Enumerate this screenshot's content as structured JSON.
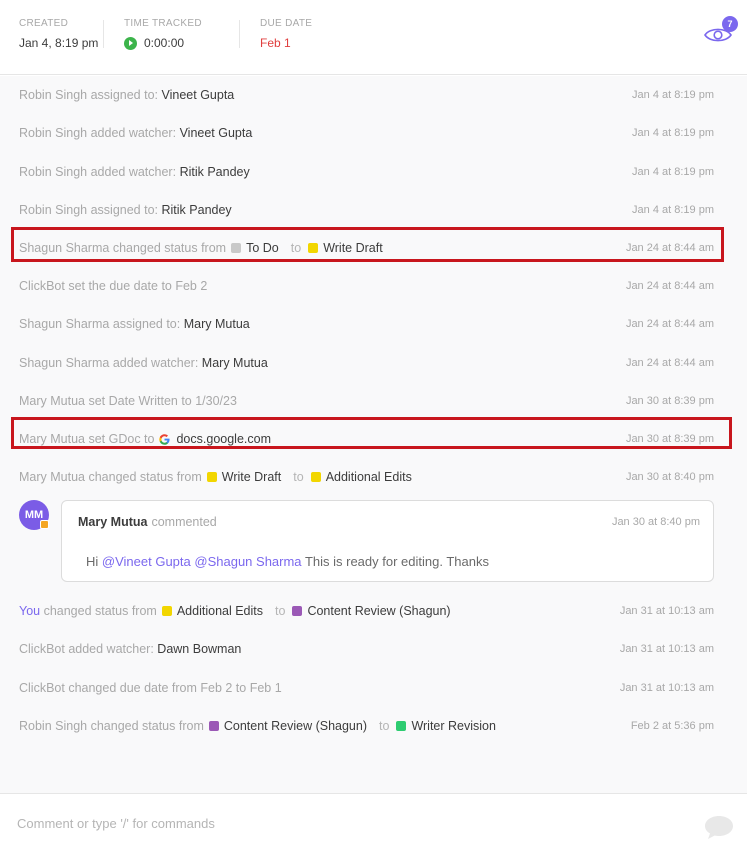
{
  "header": {
    "created": {
      "label": "CREATED",
      "value": "Jan 4, 8:19 pm"
    },
    "time_tracked": {
      "label": "TIME TRACKED",
      "value": "0:00:00"
    },
    "due_date": {
      "label": "DUE DATE",
      "value": "Feb 1"
    },
    "watchers_count": "7"
  },
  "colors": {
    "todo": "#c9c9c9",
    "write_draft": "#f2d600",
    "additional_edits": "#f2d600",
    "content_review": "#9b59b6",
    "writer_revision": "#2ecc71",
    "accent": "#7b68ee",
    "highlight": "#c8161d"
  },
  "activity": [
    {
      "actor": "Robin Singh",
      "action": "assigned to:",
      "target": "Vineet Gupta",
      "time": "Jan 4 at 8:19 pm"
    },
    {
      "actor": "Robin Singh",
      "action": "added watcher:",
      "target": "Vineet Gupta",
      "time": "Jan 4 at 8:19 pm"
    },
    {
      "actor": "Robin Singh",
      "action": "added watcher:",
      "target": "Ritik Pandey",
      "time": "Jan 4 at 8:19 pm"
    },
    {
      "actor": "Robin Singh",
      "action": "assigned to:",
      "target": "Ritik Pandey",
      "time": "Jan 4 at 8:19 pm"
    },
    {
      "actor": "Shagun Sharma",
      "action": "changed status from",
      "from": "To Do",
      "to_word": "to",
      "to": "Write Draft",
      "time": "Jan 24 at 8:44 am"
    },
    {
      "text": "ClickBot set the due date to Feb 2",
      "time": "Jan 24 at 8:44 am"
    },
    {
      "actor": "Shagun Sharma",
      "action": "assigned to:",
      "target": "Mary Mutua",
      "time": "Jan 24 at 8:44 am"
    },
    {
      "actor": "Shagun Sharma",
      "action": "added watcher:",
      "target": "Mary Mutua",
      "time": "Jan 24 at 8:44 am"
    },
    {
      "text": "Mary Mutua set Date Written to 1/30/23",
      "time": "Jan 30 at 8:39 pm"
    },
    {
      "actor": "Mary Mutua",
      "action": "set GDoc to",
      "target": "docs.google.com",
      "time": "Jan 30 at 8:39 pm"
    },
    {
      "actor": "Mary Mutua",
      "action": "changed status from",
      "from": "Write Draft",
      "to_word": "to",
      "to": "Additional Edits",
      "time": "Jan 30 at 8:40 pm"
    }
  ],
  "comment": {
    "avatar_initials": "MM",
    "author": "Mary Mutua",
    "verb": "commented",
    "time": "Jan 30 at 8:40 pm",
    "greeting": "Hi",
    "mention1": "@Vineet Gupta",
    "mention2": "@Shagun Sharma",
    "body": "This is ready for editing. Thanks"
  },
  "activity_after": [
    {
      "actor": "You",
      "action": "changed status from",
      "from": "Additional Edits",
      "to_word": "to",
      "to": "Content Review (Shagun)",
      "time": "Jan 31 at 10:13 am"
    },
    {
      "actor": "ClickBot",
      "action": "added watcher:",
      "target": "Dawn Bowman",
      "time": "Jan 31 at 10:13 am"
    },
    {
      "text": "ClickBot changed due date from Feb 2 to Feb 1",
      "time": "Jan 31 at 10:13 am"
    },
    {
      "actor": "Robin Singh",
      "action": "changed status from",
      "from": "Content Review (Shagun)",
      "to_word": "to",
      "to": "Writer Revision",
      "time": "Feb 2 at 5:36 pm"
    }
  ],
  "footer": {
    "placeholder": "Comment or type '/' for commands"
  }
}
